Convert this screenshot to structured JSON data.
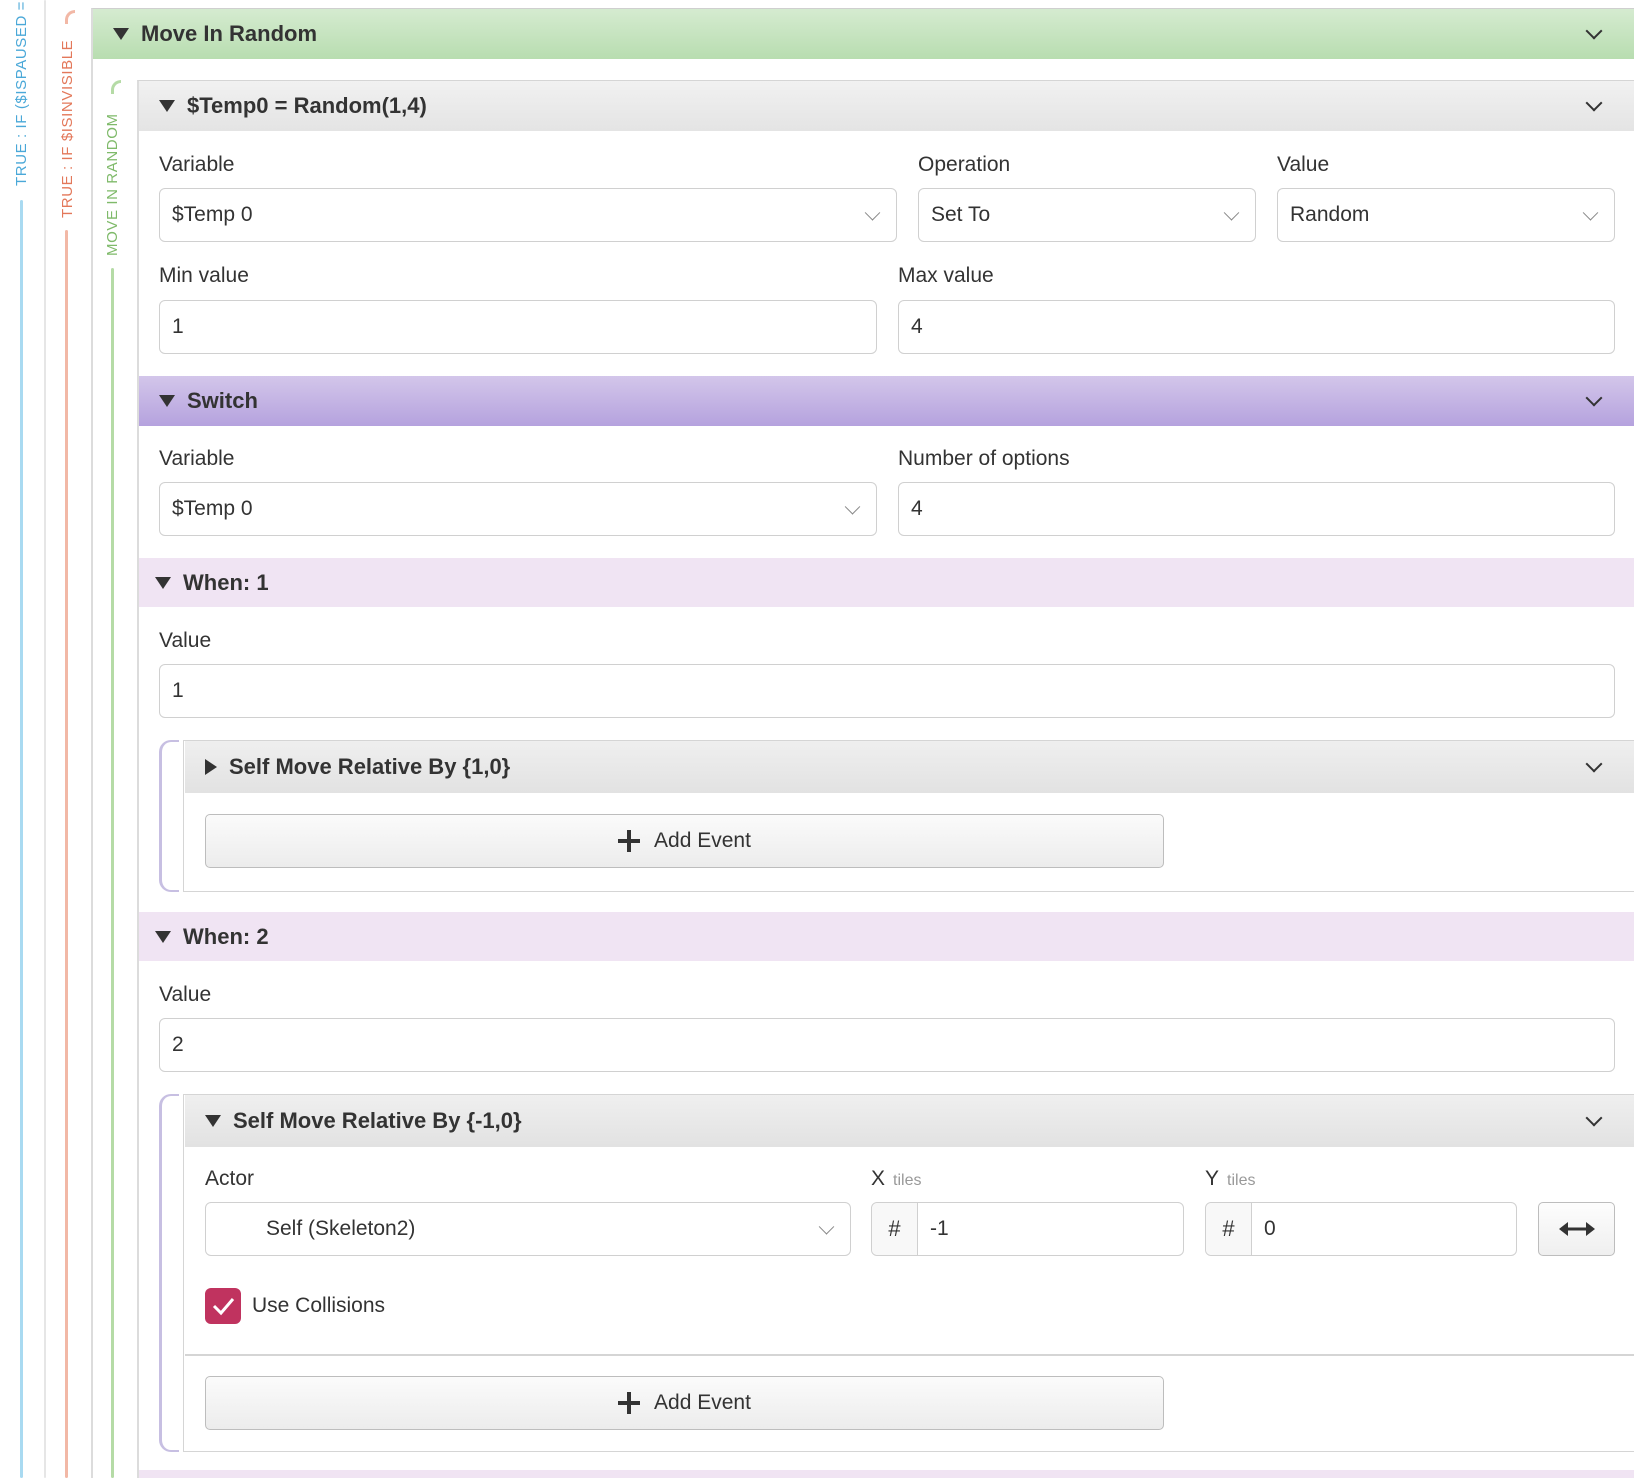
{
  "gutter": {
    "label1": "TRUE : IF ($ISPAUSED =",
    "label2": "TRUE : IF $ISINVISIBLE",
    "label3": "MOVE IN RANDOM",
    "colors": {
      "blue": "#4aa8d8",
      "orange": "#e3785a",
      "green": "#7fba6a"
    }
  },
  "group": {
    "title": "Move In Random"
  },
  "temp": {
    "title": "$Temp0 = Random(1,4)",
    "variable_label": "Variable",
    "variable_value": "$Temp 0",
    "operation_label": "Operation",
    "operation_value": "Set To",
    "value_label": "Value",
    "value_value": "Random",
    "min_label": "Min value",
    "min_value": "1",
    "max_label": "Max value",
    "max_value": "4"
  },
  "switch": {
    "title": "Switch",
    "variable_label": "Variable",
    "variable_value": "$Temp 0",
    "options_label": "Number of options",
    "options_value": "4"
  },
  "when1": {
    "title": "When: 1",
    "value_label": "Value",
    "value": "1",
    "event_title": "Self Move Relative By {1,0}",
    "add_event": "Add Event"
  },
  "when2": {
    "title": "When: 2",
    "value_label": "Value",
    "value": "2",
    "event_title": "Self Move Relative By {-1,0}",
    "actor_label": "Actor",
    "actor_value": "Self (Skeleton2)",
    "x_label": "X",
    "x_unit": "tiles",
    "x_hash": "#",
    "x_value": "-1",
    "y_label": "Y",
    "y_unit": "tiles",
    "y_hash": "#",
    "y_value": "0",
    "swap_icon": "horizontal-arrows-icon",
    "collisions_label": "Use Collisions",
    "collisions_checked": true,
    "add_event": "Add Event"
  }
}
